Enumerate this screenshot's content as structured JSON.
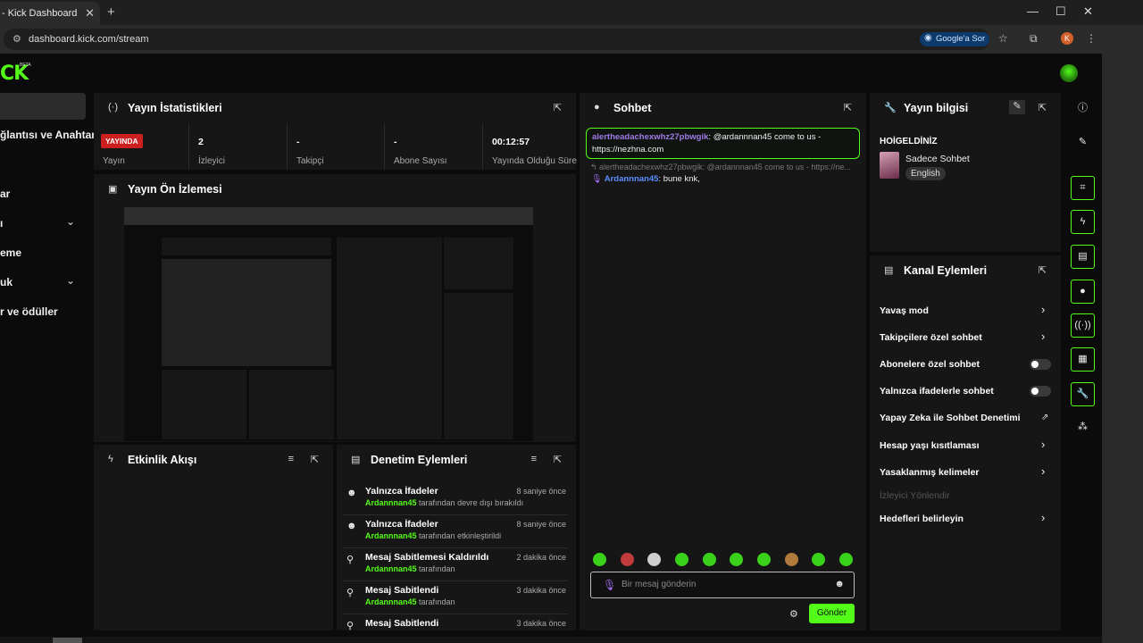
{
  "browser": {
    "tab_title": "- Kick Dashboard",
    "url": "dashboard.kick.com/stream",
    "google_pill": "Google'a Sor",
    "profile_initial": "K"
  },
  "logo": {
    "text": "CK",
    "badge": "BETA"
  },
  "sidebar": {
    "items": [
      {
        "label": "ğlantısı ve Anahtarı",
        "chevron": false
      },
      {
        "label": "ar",
        "chevron": false
      },
      {
        "label": "ı",
        "chevron": true
      },
      {
        "label": "eme",
        "chevron": false
      },
      {
        "label": "uk",
        "chevron": true
      },
      {
        "label": "r ve ödüller",
        "chevron": false
      }
    ]
  },
  "stats": {
    "title": "Yayın İstatistikleri",
    "live_badge": "YAYINDA",
    "items": [
      {
        "value": "",
        "label": "Yayın"
      },
      {
        "value": "2",
        "label": "İzleyici"
      },
      {
        "value": "-",
        "label": "Takipçi"
      },
      {
        "value": "-",
        "label": "Abone Sayısı"
      },
      {
        "value": "00:12:57",
        "label": "Yayında Olduğu Süre"
      }
    ]
  },
  "preview": {
    "title": "Yayın Ön İzlemesi"
  },
  "activity": {
    "title": "Etkinlik Akışı"
  },
  "moderation": {
    "title": "Denetim Eylemleri",
    "items": [
      {
        "title": "Yalnızca İfadeler",
        "user": "Ardannnan45",
        "detail": "tarafından devre dışı bırakıldı",
        "time": "8 saniye önce"
      },
      {
        "title": "Yalnızca İfadeler",
        "user": "Ardannnan45",
        "detail": "tarafından etkinleştirildi",
        "time": "8 saniye önce"
      },
      {
        "title": "Mesaj Sabitlemesi Kaldırıldı",
        "user": "Ardannnan45",
        "detail": "tarafından",
        "time": "2 dakika önce"
      },
      {
        "title": "Mesaj Sabitlendi",
        "user": "Ardannnan45",
        "detail": "tarafından",
        "time": "3 dakika önce"
      },
      {
        "title": "Mesaj Sabitlendi",
        "user": "",
        "detail": "",
        "time": "3 dakika önce"
      }
    ]
  },
  "chat": {
    "title": "Sohbet",
    "highlight_user": "alertheadachexwhz27pbwgik",
    "highlight_text": ": @ardannnan45 come to us - https://nezhna.com",
    "reply_line": "alertheadachexwhz27pbwgik: @ardannnan45 come to us - https://ne...",
    "message_user": "Ardannnan45",
    "message_text": ": bune knk,",
    "input_placeholder": "Bir mesaj gönderin",
    "send_label": "Gönder"
  },
  "info": {
    "title": "Yayın bilgisi",
    "welcome": "HOİGELDİNİZ",
    "category": "Sadece Sohbet",
    "language": "English"
  },
  "channel_actions": {
    "title": "Kanal Eylemleri",
    "items": [
      {
        "label": "Yavaş mod",
        "control": "chevron"
      },
      {
        "label": "Takipçilere özel sohbet",
        "control": "chevron"
      },
      {
        "label": "Abonelere özel sohbet",
        "control": "toggle"
      },
      {
        "label": "Yalnızca ifadelerle sohbet",
        "control": "toggle"
      },
      {
        "label": "Yapay Zeka ile Sohbet Denetimi",
        "control": "external"
      },
      {
        "label": "Hesap yaşı kısıtlaması",
        "control": "chevron"
      },
      {
        "label": "Yasaklanmış kelimeler",
        "control": "chevron"
      },
      {
        "label": "İzleyici Yönlendir",
        "control": "none"
      },
      {
        "label": "Hedefleri belirleyin",
        "control": "chevron"
      }
    ]
  },
  "colors": {
    "accent": "#53fc18",
    "live": "#cc1f1f",
    "panel": "#161616"
  }
}
